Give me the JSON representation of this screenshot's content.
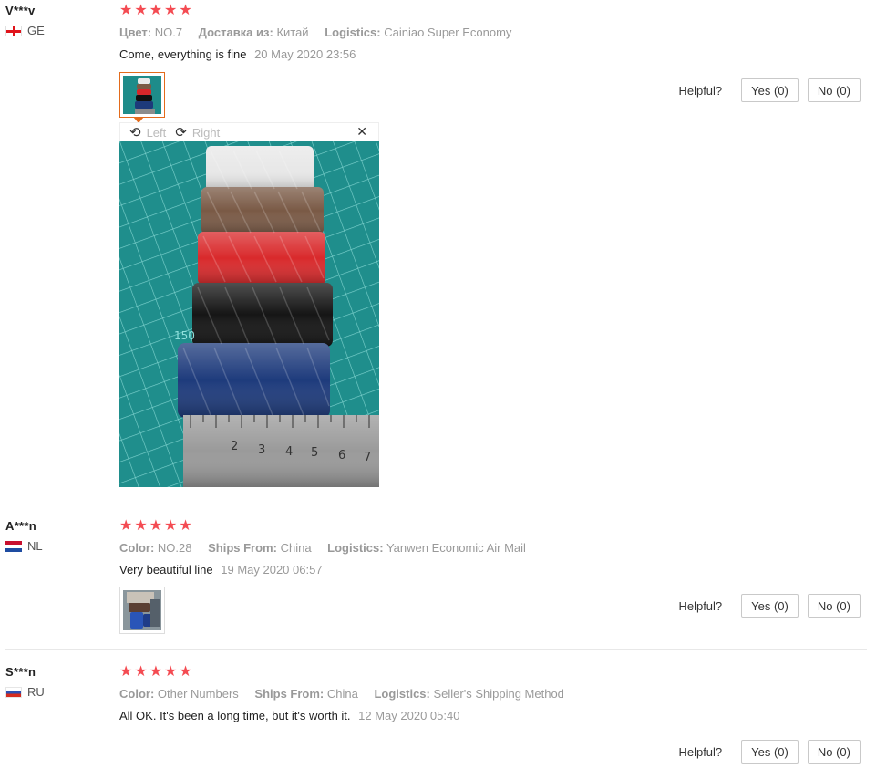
{
  "reviews": [
    {
      "user": "V***v",
      "country": "GE",
      "stars": "★★★★★",
      "meta": [
        {
          "key": "Цвет:",
          "value": "NO.7"
        },
        {
          "key": "Доставка из:",
          "value": "Китай"
        },
        {
          "key": "Logistics:",
          "value": "Cainiao Super Economy"
        }
      ],
      "comment": "Come, everything is fine",
      "date": "20 May 2020 23:56",
      "helpful_label": "Helpful?",
      "yes_label": "Yes (0)",
      "no_label": "No (0)"
    },
    {
      "user": "A***n",
      "country": "NL",
      "stars": "★★★★★",
      "meta": [
        {
          "key": "Color:",
          "value": "NO.28"
        },
        {
          "key": "Ships From:",
          "value": "China"
        },
        {
          "key": "Logistics:",
          "value": "Yanwen Economic Air Mail"
        }
      ],
      "comment": "Very beautiful line",
      "date": "19 May 2020 06:57",
      "helpful_label": "Helpful?",
      "yes_label": "Yes (0)",
      "no_label": "No (0)"
    },
    {
      "user": "S***n",
      "country": "RU",
      "stars": "★★★★★",
      "meta": [
        {
          "key": "Color:",
          "value": "Other Numbers"
        },
        {
          "key": "Ships From:",
          "value": "China"
        },
        {
          "key": "Logistics:",
          "value": "Seller's Shipping Method"
        }
      ],
      "comment": "All OK. It's been a long time, but it's worth it.",
      "date": "12 May 2020 05:40",
      "helpful_label": "Helpful?",
      "yes_label": "Yes (0)",
      "no_label": "No (0)"
    }
  ],
  "viewer": {
    "rotate_left_label": "Left",
    "rotate_right_label": "Right",
    "rotate_left_icon": "rotate-left-icon",
    "rotate_right_icon": "rotate-right-icon",
    "close_icon": "close-icon",
    "ruler_number": "150",
    "ruler_ticks": [
      "2",
      "3",
      "4",
      "5",
      "6",
      "7"
    ]
  },
  "colors": {
    "star": "#f44b52",
    "thumb_active_border": "#e36b1c",
    "cutting_mat": "#1e8c8a",
    "muted_text": "#999999"
  }
}
